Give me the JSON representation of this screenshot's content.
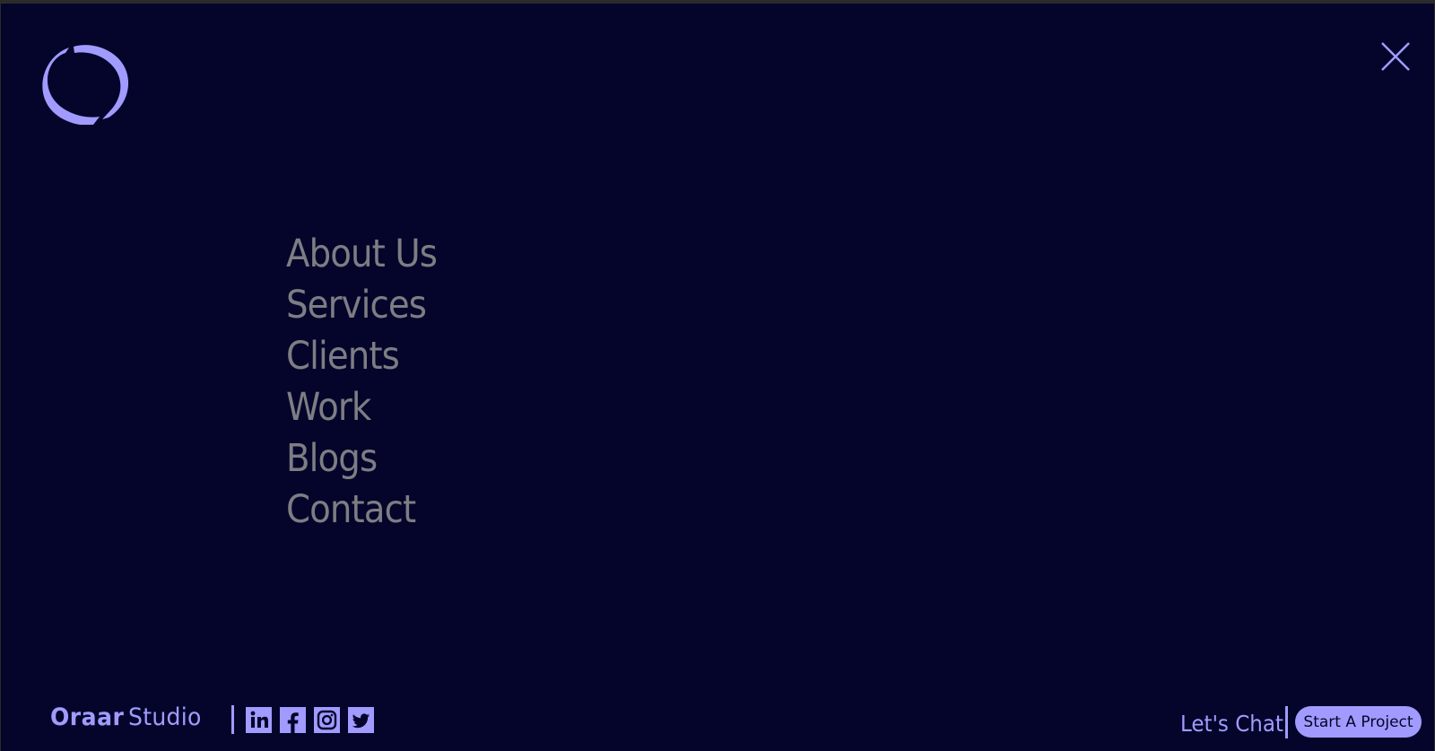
{
  "menu": {
    "items": [
      {
        "label": "About Us"
      },
      {
        "label": "Services"
      },
      {
        "label": "Clients"
      },
      {
        "label": "Work"
      },
      {
        "label": "Blogs"
      },
      {
        "label": "Contact"
      }
    ]
  },
  "icons": {
    "logo": "brand-logo-icon",
    "close": "close-icon",
    "linkedin": "linkedin-icon",
    "facebook": "facebook-icon",
    "instagram": "instagram-icon",
    "twitter": "twitter-icon"
  },
  "footer": {
    "brand_primary": "Oraar",
    "brand_secondary": "Studio",
    "chat_label": "Let's Chat",
    "cta_label": "Start A Project"
  },
  "colors": {
    "background": "#05052b",
    "frame": "#2b2b2b",
    "accent": "#a19bff",
    "menu_text": "#7d7d84"
  }
}
